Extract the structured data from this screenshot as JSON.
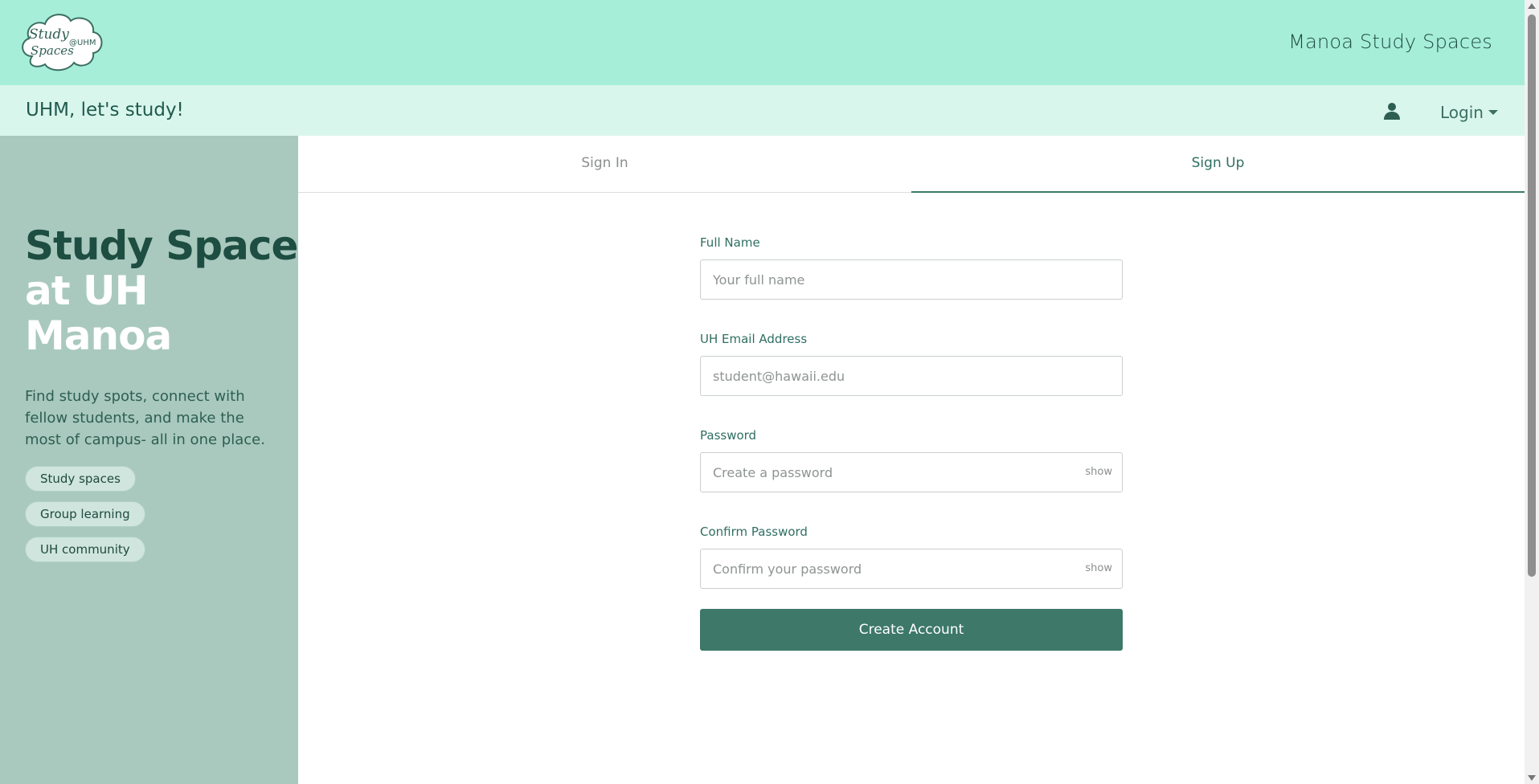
{
  "header": {
    "logo_text_line1": "Study",
    "logo_text_line2": "Spaces",
    "logo_text_tag": "@UHM",
    "brand_title": "Manoa Study Spaces"
  },
  "subheader": {
    "tagline": "UHM, let's study!",
    "user_icon": "user-icon",
    "login_label": "Login"
  },
  "sidebar": {
    "hero_dark": "Study Spaces",
    "hero_light_1": "at UH",
    "hero_light_2": "Manoa",
    "description": "Find study spots, connect with fellow students, and make the most of campus- all in one place.",
    "chips": [
      "Study spaces",
      "Group learning",
      "UH community"
    ]
  },
  "tabs": {
    "sign_in": "Sign In",
    "sign_up": "Sign Up",
    "active": "Sign Up"
  },
  "form": {
    "full_name_label": "Full Name",
    "full_name_placeholder": "Your full name",
    "email_label": "UH Email Address",
    "email_placeholder": "student@hawaii.edu",
    "password_label": "Password",
    "password_placeholder": "Create a password",
    "confirm_label": "Confirm Password",
    "confirm_placeholder": "Confirm your password",
    "show_label": "show",
    "submit_label": "Create Account"
  },
  "colors": {
    "topbar": "#a6eed8",
    "subbar": "#d9f6ec",
    "sidebar": "#a9c9be",
    "accent": "#3d7868"
  }
}
